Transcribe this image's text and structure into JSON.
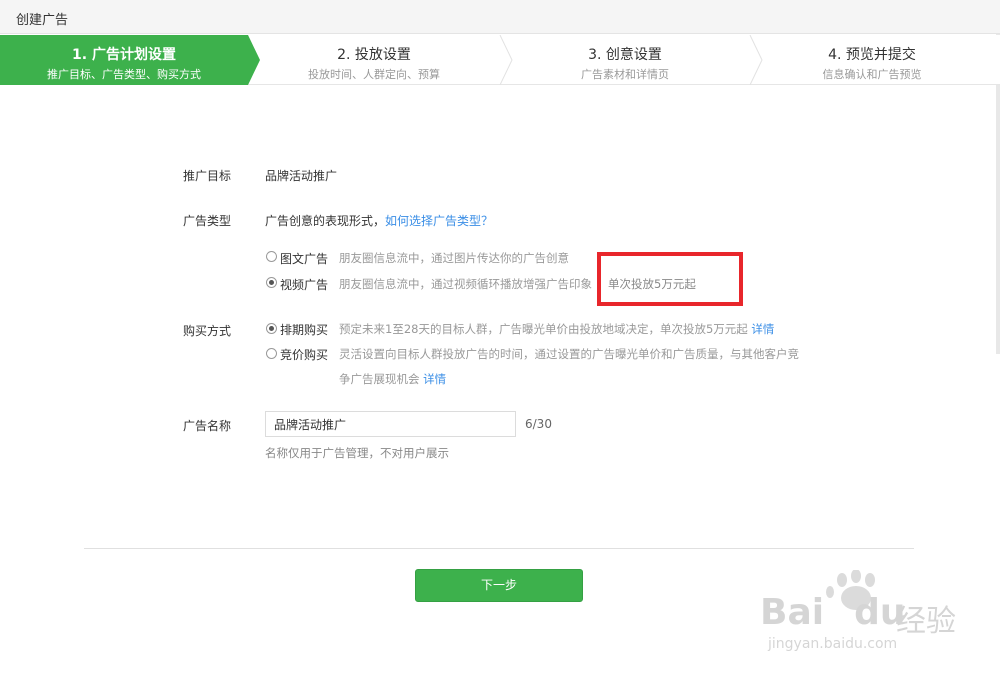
{
  "header": {
    "title": "创建广告"
  },
  "steps": [
    {
      "title": "1. 广告计划设置",
      "subtitle": "推广目标、广告类型、购买方式",
      "active": true
    },
    {
      "title": "2. 投放设置",
      "subtitle": "投放时间、人群定向、预算",
      "active": false
    },
    {
      "title": "3. 创意设置",
      "subtitle": "广告素材和详情页",
      "active": false
    },
    {
      "title": "4. 预览并提交",
      "subtitle": "信息确认和广告预览",
      "active": false
    }
  ],
  "form": {
    "target": {
      "label": "推广目标",
      "value": "品牌活动推广"
    },
    "ad_type": {
      "label": "广告类型",
      "hint": "广告创意的表现形式，",
      "hint_link": "如何选择广告类型？",
      "options": [
        {
          "label": "图文广告",
          "desc": "朋友圈信息流中，通过图片传达你的广告创意",
          "checked": false
        },
        {
          "label": "视频广告",
          "desc": "朋友圈信息流中，通过视频循环播放增强广告印象",
          "extra": "单次投放5万元起",
          "checked": true
        }
      ]
    },
    "purchase": {
      "label": "购买方式",
      "options": [
        {
          "label": "排期购买",
          "desc": "预定未来1至28天的目标人群，广告曝光单价由投放地域决定，单次投放5万元起",
          "link": "详情",
          "checked": true
        },
        {
          "label": "竞价购买",
          "desc": "灵活设置向目标人群投放广告的时间，通过设置的广告曝光单价和广告质量，与其他客户竞",
          "desc2": "争广告展现机会",
          "link": "详情",
          "checked": false
        }
      ]
    },
    "name": {
      "label": "广告名称",
      "value": "品牌活动推广",
      "counter": "6/30",
      "hint": "名称仅用于广告管理，不对用户展示"
    }
  },
  "next_button": {
    "label": "下一步"
  },
  "watermark": {
    "brand_latin": "Bai",
    "brand_latin2": "du",
    "brand_cn": "经验",
    "url": "jingyan.baidu.com"
  },
  "colors": {
    "accent": "#3db14c",
    "link": "#3a8ee6",
    "highlight": "#e8262b"
  }
}
